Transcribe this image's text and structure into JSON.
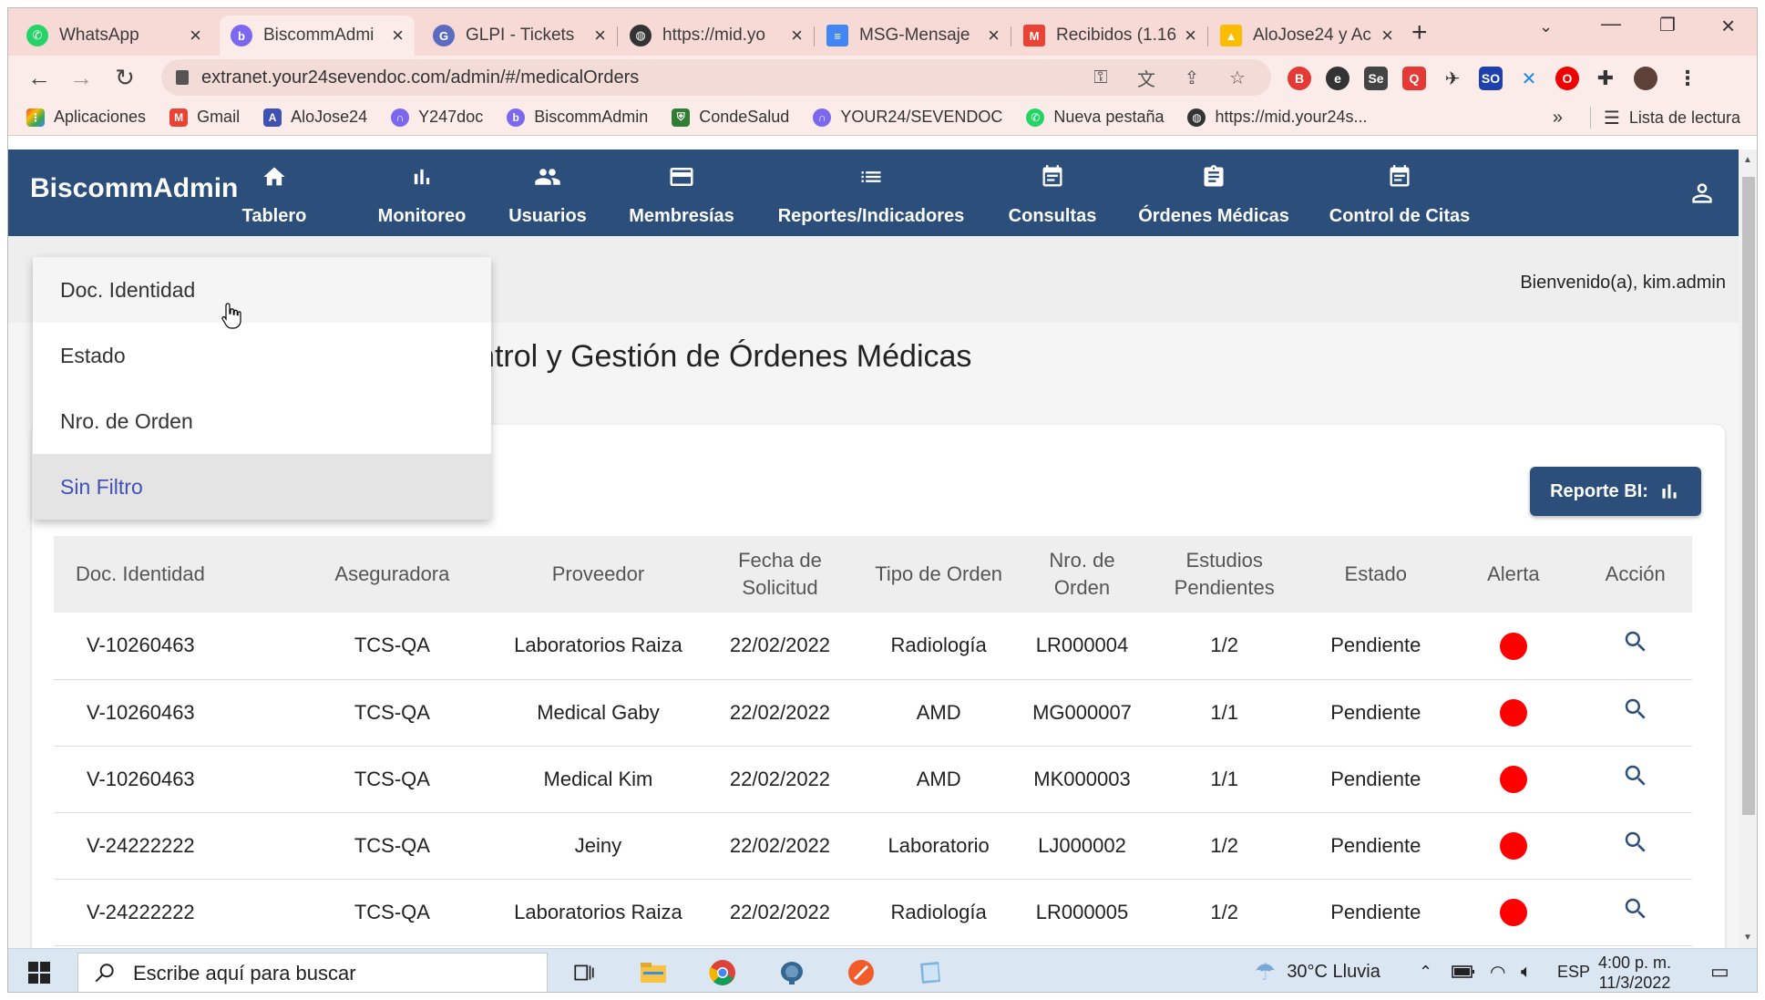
{
  "browser": {
    "tabs": [
      {
        "label": "WhatsApp",
        "icon": "whatsapp-icon",
        "color": "#25d366"
      },
      {
        "label": "BiscommAdmi",
        "icon": "biscomm-icon",
        "color": "#7b68ee"
      },
      {
        "label": "GLPI - Tickets",
        "icon": "glpi-icon",
        "color": "#5c6bc0"
      },
      {
        "label": "https://mid.yo",
        "icon": "globe-icon",
        "color": "#333333"
      },
      {
        "label": "MSG-Mensaje",
        "icon": "docs-icon",
        "color": "#4285f4"
      },
      {
        "label": "Recibidos (1.16",
        "icon": "gmail-icon",
        "color": "#ea4335"
      },
      {
        "label": "AloJose24 y Ac",
        "icon": "drive-icon",
        "color": "#fbbc04"
      }
    ],
    "url": "extranet.your24sevendoc.com/admin/#/medicalOrders",
    "bookmarks": [
      {
        "label": "Aplicaciones",
        "icon": "apps-grid-icon",
        "color": "#ea4335"
      },
      {
        "label": "Gmail",
        "icon": "gmail-icon",
        "color": "#ea4335"
      },
      {
        "label": "AloJose24",
        "icon": "alojose-icon",
        "color": "#3f51b5"
      },
      {
        "label": "Y247doc",
        "icon": "y247-icon",
        "color": "#7b68ee"
      },
      {
        "label": "BiscommAdmin",
        "icon": "biscomm-icon",
        "color": "#7b68ee"
      },
      {
        "label": "CondeSalud",
        "icon": "shield-icon",
        "color": "#2e7d32"
      },
      {
        "label": "YOUR24/SEVENDOC",
        "icon": "your24-icon",
        "color": "#7b68ee"
      },
      {
        "label": "Nueva pestaña",
        "icon": "whatsapp-icon",
        "color": "#25d366"
      },
      {
        "label": "https://mid.your24s...",
        "icon": "globe-icon",
        "color": "#333333"
      }
    ],
    "bookmarks_more": "»",
    "reading_list": "Lista de lectura"
  },
  "app": {
    "brand": "BiscommAdmin",
    "nav": [
      {
        "label": "Tablero",
        "icon": "home-icon"
      },
      {
        "label": "Monitoreo",
        "icon": "bar-chart-icon"
      },
      {
        "label": "Usuarios",
        "icon": "users-icon"
      },
      {
        "label": "Membresías",
        "icon": "credit-card-icon"
      },
      {
        "label": "Reportes/Indicadores",
        "icon": "list-icon"
      },
      {
        "label": "Consultas",
        "icon": "calendar-icon"
      },
      {
        "label": "Órdenes Médicas",
        "icon": "clipboard-icon"
      },
      {
        "label": "Control de Citas",
        "icon": "calendar-icon"
      }
    ],
    "welcome": "Bienvenido(a), kim.admin",
    "page_title": "Control y Gestión de Órdenes Médicas",
    "report_button": "Reporte BI:",
    "filter_menu": [
      "Doc. Identidad",
      "Estado",
      "Nro. de Orden",
      "Sin Filtro"
    ]
  },
  "table": {
    "headers": [
      "Doc. Identidad",
      "Aseguradora",
      "Proveedor",
      "Fecha de Solicitud",
      "Tipo de Orden",
      "Nro. de Orden",
      "Estudios Pendientes",
      "Estado",
      "Alerta",
      "Acción"
    ],
    "rows": [
      [
        "V-10260463",
        "TCS-QA",
        "Laboratorios Raiza",
        "22/02/2022",
        "Radiología",
        "LR000004",
        "1/2",
        "Pendiente"
      ],
      [
        "V-10260463",
        "TCS-QA",
        "Medical Gaby",
        "22/02/2022",
        "AMD",
        "MG000007",
        "1/1",
        "Pendiente"
      ],
      [
        "V-10260463",
        "TCS-QA",
        "Medical Kim",
        "22/02/2022",
        "AMD",
        "MK000003",
        "1/1",
        "Pendiente"
      ],
      [
        "V-24222222",
        "TCS-QA",
        "Jeiny",
        "22/02/2022",
        "Laboratorio",
        "LJ000002",
        "1/2",
        "Pendiente"
      ],
      [
        "V-24222222",
        "TCS-QA",
        "Laboratorios Raiza",
        "22/02/2022",
        "Radiología",
        "LR000005",
        "1/2",
        "Pendiente"
      ]
    ],
    "alert_color": "#ff0000"
  },
  "taskbar": {
    "search_placeholder": "Escribe aquí para buscar",
    "weather": "30°C  Lluvia",
    "language": "ESP",
    "time": "4:00 p. m.",
    "date": "11/3/2022"
  },
  "colors": {
    "header": "#2b4f7a",
    "chrome": "#f7d9d5",
    "accent": "#3f51b5"
  }
}
